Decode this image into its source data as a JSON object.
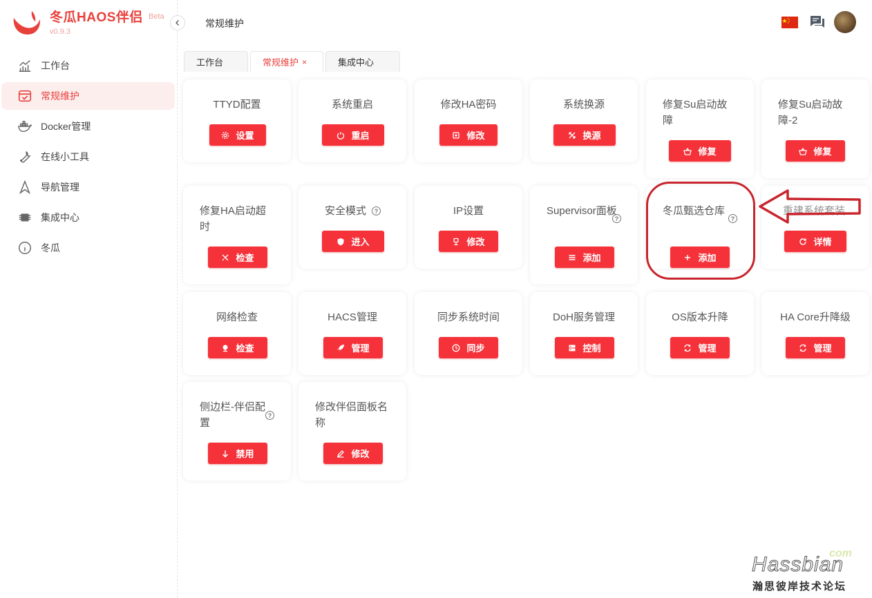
{
  "brand": {
    "title": "冬瓜HAOS伴侣",
    "badge": "Beta",
    "version": "v0.9.3"
  },
  "sidebar": {
    "items": [
      {
        "label": "工作台",
        "icon": "chart-icon",
        "active": false
      },
      {
        "label": "常规维护",
        "icon": "maintenance-icon",
        "active": true
      },
      {
        "label": "Docker管理",
        "icon": "docker-icon",
        "active": false
      },
      {
        "label": "在线小工具",
        "icon": "wrench-icon",
        "active": false
      },
      {
        "label": "导航管理",
        "icon": "navigation-icon",
        "active": false
      },
      {
        "label": "集成中心",
        "icon": "chip-icon",
        "active": false
      },
      {
        "label": "冬瓜",
        "icon": "info-icon",
        "active": false
      }
    ]
  },
  "header": {
    "title": "常规维护",
    "language_flag": "cn-flag-icon",
    "chat_icon": "chat-icon"
  },
  "tabs": [
    {
      "label": "工作台",
      "active": false
    },
    {
      "label": "常规维护",
      "active": true,
      "close": "×"
    },
    {
      "label": "集成中心",
      "active": false
    }
  ],
  "cards": [
    {
      "title": "TTYD配置",
      "button": "设置",
      "icon": "gear-icon"
    },
    {
      "title": "系统重启",
      "button": "重启",
      "icon": "power-icon"
    },
    {
      "title": "修改HA密码",
      "button": "修改",
      "icon": "key-icon"
    },
    {
      "title": "系统换源",
      "button": "换源",
      "icon": "switch-icon"
    },
    {
      "title": "修复Su启动故障",
      "button": "修复",
      "icon": "basket-icon"
    },
    {
      "title": "修复Su启动故障-2",
      "button": "修复",
      "icon": "basket-icon"
    },
    {
      "title": "修复HA启动超时",
      "button": "检查",
      "icon": "tools-icon"
    },
    {
      "title": "安全模式",
      "button": "进入",
      "icon": "shield-icon",
      "help": "?"
    },
    {
      "title": "IP设置",
      "button": "修改",
      "icon": "plug-icon"
    },
    {
      "title": "Supervisor面板",
      "button": "添加",
      "icon": "list-icon",
      "help": "?"
    },
    {
      "title": "冬瓜甄选仓库",
      "button": "添加",
      "icon": "plus-icon",
      "help": "?"
    },
    {
      "title": "重建系统套装",
      "button": "详情",
      "icon": "refresh-icon"
    },
    {
      "title": "网络检查",
      "button": "检查",
      "icon": "network-icon"
    },
    {
      "title": "HACS管理",
      "button": "管理",
      "icon": "rocket-icon"
    },
    {
      "title": "同步系统时间",
      "button": "同步",
      "icon": "clock-icon"
    },
    {
      "title": "DoH服务管理",
      "button": "控制",
      "icon": "server-icon"
    },
    {
      "title": "OS版本升降",
      "button": "管理",
      "icon": "sync-icon"
    },
    {
      "title": "HA Core升降级",
      "button": "管理",
      "icon": "sync-icon"
    },
    {
      "title": "侧边栏-伴侣配置",
      "button": "禁用",
      "icon": "arrow-down-icon",
      "help": "?"
    },
    {
      "title": "修改伴侣面板名称",
      "button": "修改",
      "icon": "edit-icon"
    }
  ],
  "watermark": {
    "top": "com",
    "main": "Hassbian",
    "sub": "瀚思彼岸技术论坛"
  },
  "colors": {
    "accent": "#e8413c",
    "button": "#f5323a",
    "annotation": "#c8242c"
  }
}
